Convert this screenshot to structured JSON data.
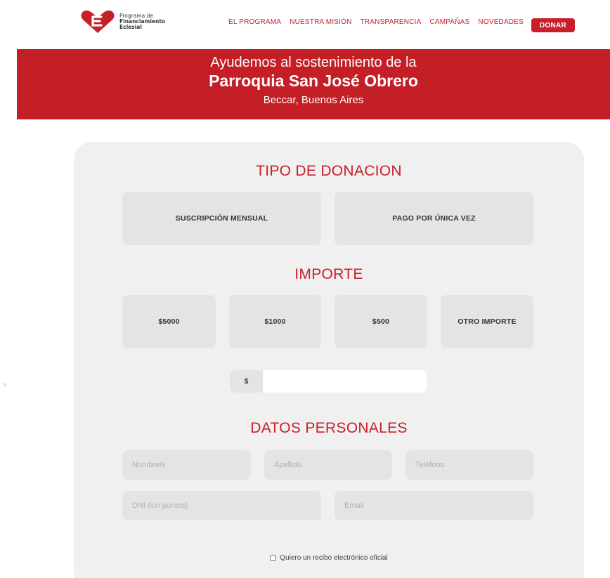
{
  "header": {
    "logo_line1": "Programa de",
    "logo_line2": "Financiamiento",
    "logo_line3": "Eclesial",
    "nav": [
      "EL PROGRAMA",
      "NUESTRA MISIÓN",
      "TRANSPARENCIA",
      "CAMPAÑAS",
      "NOVEDADES"
    ],
    "donate_label": "DONAR"
  },
  "hero": {
    "line1": "Ayudemos al sostenimiento de la",
    "line2": "Parroquia San José Obrero",
    "line3": "Beccar, Buenos Aires"
  },
  "form": {
    "type_title": "TIPO DE DONACION",
    "type_options": [
      "SUSCRIPCIÓN MENSUAL",
      "PAGO POR ÚNICA VEZ"
    ],
    "amount_title": "IMPORTE",
    "amounts": [
      "$5000",
      "$1000",
      "$500",
      "OTRO IMPORTE"
    ],
    "currency_prefix": "$",
    "custom_amount_value": "",
    "personal_title": "DATOS PERSONALES",
    "fields": {
      "nombre": "Nombre/s",
      "apellido": "Apellido",
      "telefono": "Teléfono",
      "dni": "DNI (sin puntos)",
      "email": "Email"
    },
    "receipt_label": "Quiero un recibo electrónico oficial",
    "receipt_checked": false
  },
  "colors": {
    "brand_red": "#c8202a",
    "card_bg": "#f0f0f0",
    "tile_bg": "#e4e4e4"
  }
}
